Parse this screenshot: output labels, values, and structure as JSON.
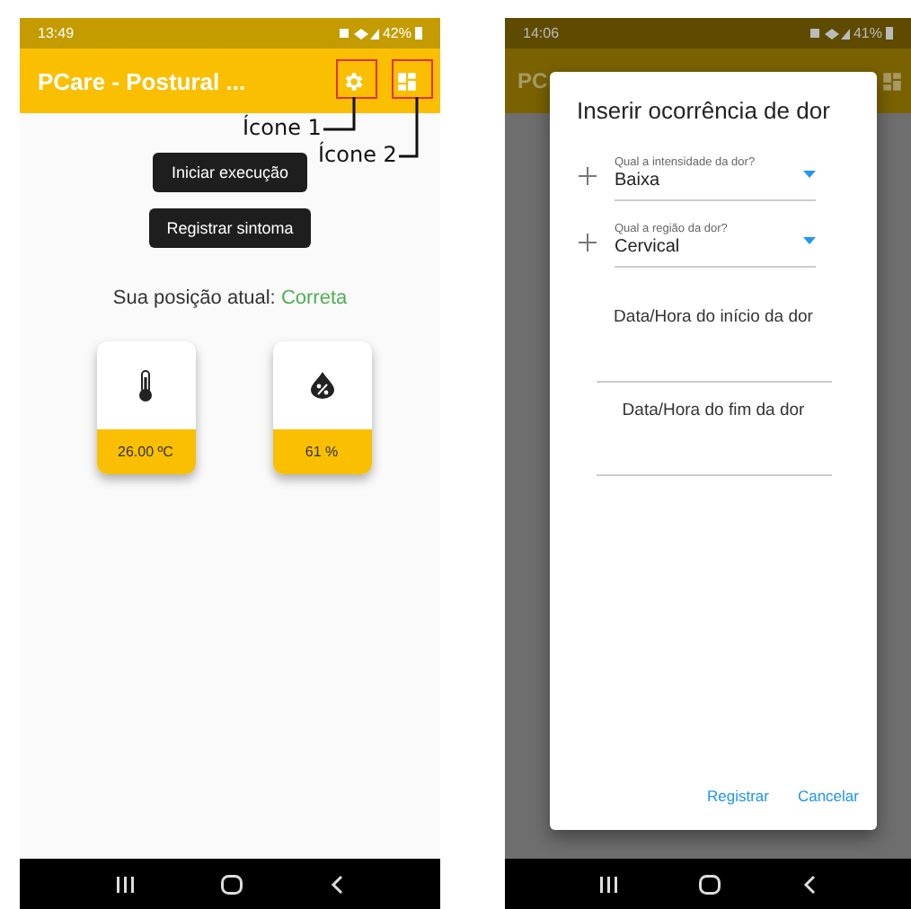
{
  "left_screen": {
    "status_bar": {
      "time": "13:49",
      "battery": "42%"
    },
    "app_bar": {
      "title": "PCare - Postural ..."
    },
    "annotations": [
      {
        "label": "Ícone 1"
      },
      {
        "label": "Ícone 2"
      }
    ],
    "buttons": [
      "Iniciar execução",
      "Registrar sintoma"
    ],
    "position": {
      "label": "Sua posição atual:",
      "value": "Correta"
    },
    "sensors": [
      {
        "kind": "temperature",
        "value": "26.00 ºC"
      },
      {
        "kind": "humidity",
        "value": "61 %"
      }
    ]
  },
  "right_screen": {
    "status_bar": {
      "time": "14:06",
      "battery": "41%"
    },
    "app_bar": {
      "title": "PC"
    },
    "dialog": {
      "title": "Inserir ocorrência de dor",
      "selects": [
        {
          "label": "Qual a intensidade da dor?",
          "value": "Baixa"
        },
        {
          "label": "Qual a região da dor?",
          "value": "Cervical"
        }
      ],
      "date_fields": [
        {
          "label": "Data/Hora do início da dor"
        },
        {
          "label": "Data/Hora do fim da dor"
        }
      ],
      "actions": [
        "Registrar",
        "Cancelar"
      ]
    }
  }
}
